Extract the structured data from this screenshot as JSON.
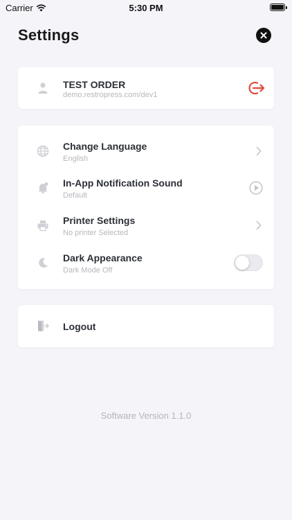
{
  "status_bar": {
    "carrier": "Carrier",
    "time": "5:30 PM"
  },
  "header": {
    "title": "Settings"
  },
  "account": {
    "name": "TEST ORDER",
    "url": "demo.restropress.com/dev1"
  },
  "settings": {
    "items": [
      {
        "label": "Change Language",
        "sub": "English"
      },
      {
        "label": "In-App Notification Sound",
        "sub": "Default"
      },
      {
        "label": "Printer Settings",
        "sub": "No printer Selected"
      },
      {
        "label": "Dark Appearance",
        "sub": "Dark Mode Off"
      }
    ]
  },
  "logout": {
    "label": "Logout"
  },
  "footer": {
    "version": "Software Version 1.1.0"
  },
  "colors": {
    "accent_red": "#e04a3c",
    "icon_gray": "#cfcfd6",
    "background": "#f4f4f9"
  }
}
